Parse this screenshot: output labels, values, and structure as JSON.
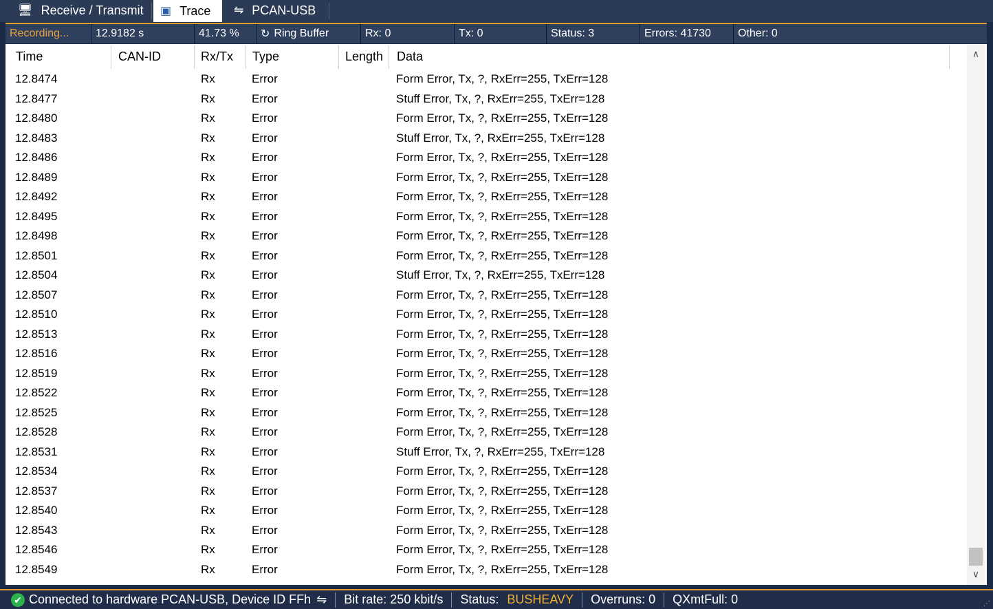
{
  "tabs": [
    {
      "label": "Receive / Transmit",
      "icon": "computer-icon"
    },
    {
      "label": "Trace",
      "icon": "trace-icon"
    },
    {
      "label": "PCAN-USB",
      "icon": "usb-icon"
    }
  ],
  "recording": {
    "state": "Recording...",
    "time": "12.9182 s",
    "percent": "41.73 %",
    "buffer": "Ring Buffer",
    "rx": "Rx: 0",
    "tx": "Tx: 0",
    "status": "Status: 3",
    "errors": "Errors: 41730",
    "other": "Other: 0"
  },
  "columns": [
    "Time",
    "CAN-ID",
    "Rx/Tx",
    "Type",
    "Length",
    "Data"
  ],
  "rows": [
    {
      "time": "12.8474",
      "rxtx": "Rx",
      "type": "Error",
      "data": "Form Error, Tx, ?, RxErr=255, TxErr=128"
    },
    {
      "time": "12.8477",
      "rxtx": "Rx",
      "type": "Error",
      "data": "Stuff Error, Tx, ?, RxErr=255, TxErr=128"
    },
    {
      "time": "12.8480",
      "rxtx": "Rx",
      "type": "Error",
      "data": "Form Error, Tx, ?, RxErr=255, TxErr=128"
    },
    {
      "time": "12.8483",
      "rxtx": "Rx",
      "type": "Error",
      "data": "Stuff Error, Tx, ?, RxErr=255, TxErr=128"
    },
    {
      "time": "12.8486",
      "rxtx": "Rx",
      "type": "Error",
      "data": "Form Error, Tx, ?, RxErr=255, TxErr=128"
    },
    {
      "time": "12.8489",
      "rxtx": "Rx",
      "type": "Error",
      "data": "Form Error, Tx, ?, RxErr=255, TxErr=128"
    },
    {
      "time": "12.8492",
      "rxtx": "Rx",
      "type": "Error",
      "data": "Form Error, Tx, ?, RxErr=255, TxErr=128"
    },
    {
      "time": "12.8495",
      "rxtx": "Rx",
      "type": "Error",
      "data": "Form Error, Tx, ?, RxErr=255, TxErr=128"
    },
    {
      "time": "12.8498",
      "rxtx": "Rx",
      "type": "Error",
      "data": "Form Error, Tx, ?, RxErr=255, TxErr=128"
    },
    {
      "time": "12.8501",
      "rxtx": "Rx",
      "type": "Error",
      "data": "Form Error, Tx, ?, RxErr=255, TxErr=128"
    },
    {
      "time": "12.8504",
      "rxtx": "Rx",
      "type": "Error",
      "data": "Stuff Error, Tx, ?, RxErr=255, TxErr=128"
    },
    {
      "time": "12.8507",
      "rxtx": "Rx",
      "type": "Error",
      "data": "Form Error, Tx, ?, RxErr=255, TxErr=128"
    },
    {
      "time": "12.8510",
      "rxtx": "Rx",
      "type": "Error",
      "data": "Form Error, Tx, ?, RxErr=255, TxErr=128"
    },
    {
      "time": "12.8513",
      "rxtx": "Rx",
      "type": "Error",
      "data": "Form Error, Tx, ?, RxErr=255, TxErr=128"
    },
    {
      "time": "12.8516",
      "rxtx": "Rx",
      "type": "Error",
      "data": "Form Error, Tx, ?, RxErr=255, TxErr=128"
    },
    {
      "time": "12.8519",
      "rxtx": "Rx",
      "type": "Error",
      "data": "Form Error, Tx, ?, RxErr=255, TxErr=128"
    },
    {
      "time": "12.8522",
      "rxtx": "Rx",
      "type": "Error",
      "data": "Form Error, Tx, ?, RxErr=255, TxErr=128"
    },
    {
      "time": "12.8525",
      "rxtx": "Rx",
      "type": "Error",
      "data": "Form Error, Tx, ?, RxErr=255, TxErr=128"
    },
    {
      "time": "12.8528",
      "rxtx": "Rx",
      "type": "Error",
      "data": "Form Error, Tx, ?, RxErr=255, TxErr=128"
    },
    {
      "time": "12.8531",
      "rxtx": "Rx",
      "type": "Error",
      "data": "Stuff Error, Tx, ?, RxErr=255, TxErr=128"
    },
    {
      "time": "12.8534",
      "rxtx": "Rx",
      "type": "Error",
      "data": "Form Error, Tx, ?, RxErr=255, TxErr=128"
    },
    {
      "time": "12.8537",
      "rxtx": "Rx",
      "type": "Error",
      "data": "Form Error, Tx, ?, RxErr=255, TxErr=128"
    },
    {
      "time": "12.8540",
      "rxtx": "Rx",
      "type": "Error",
      "data": "Form Error, Tx, ?, RxErr=255, TxErr=128"
    },
    {
      "time": "12.8543",
      "rxtx": "Rx",
      "type": "Error",
      "data": "Form Error, Tx, ?, RxErr=255, TxErr=128"
    },
    {
      "time": "12.8546",
      "rxtx": "Rx",
      "type": "Error",
      "data": "Form Error, Tx, ?, RxErr=255, TxErr=128"
    },
    {
      "time": "12.8549",
      "rxtx": "Rx",
      "type": "Error",
      "data": "Form Error, Tx, ?, RxErr=255, TxErr=128"
    }
  ],
  "statusbar": {
    "connection": "Connected to hardware PCAN-USB, Device ID FFh",
    "bitrate": "Bit rate: 250 kbit/s",
    "status_label": "Status:",
    "status_value": "BUSHEAVY",
    "overruns": "Overruns: 0",
    "qxmtfull": "QXmtFull: 0"
  },
  "colors": {
    "accent": "#e0a030",
    "background": "#1c2b45",
    "bus_status": "#f0b030",
    "connected": "#2bb24c"
  }
}
